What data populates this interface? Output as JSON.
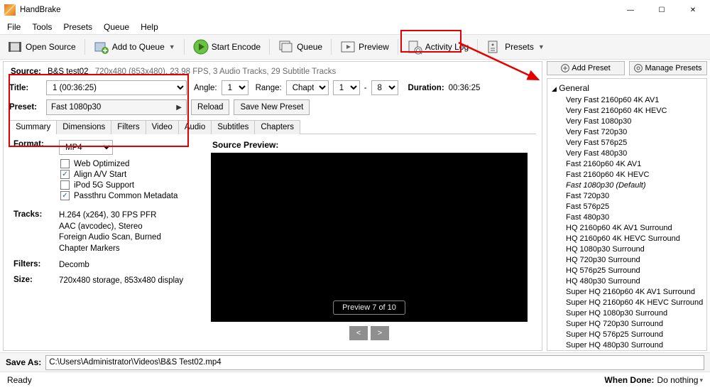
{
  "window": {
    "title": "HandBrake"
  },
  "menu": {
    "file": "File",
    "tools": "Tools",
    "presets": "Presets",
    "queue": "Queue",
    "help": "Help"
  },
  "toolbar": {
    "open_source": "Open Source",
    "add_to_queue": "Add to Queue",
    "start_encode": "Start Encode",
    "queue": "Queue",
    "preview": "Preview",
    "activity_log": "Activity Log",
    "presets": "Presets"
  },
  "source": {
    "label": "Source:",
    "name": "B&S test02",
    "meta": "720x480 (853x480), 23.98 FPS, 3 Audio Tracks, 29 Subtitle Tracks"
  },
  "title": {
    "label": "Title:",
    "value": "1  (00:36:25)",
    "angle_label": "Angle:",
    "angle_value": "1",
    "range_label": "Range:",
    "range_mode": "Chapters",
    "range_from": "1",
    "range_dash": "-",
    "range_to": "8",
    "duration_label": "Duration:",
    "duration_value": "00:36:25"
  },
  "preset": {
    "label": "Preset:",
    "value": "Fast 1080p30",
    "reload": "Reload",
    "save_new": "Save New Preset"
  },
  "tabs": {
    "summary": "Summary",
    "dimensions": "Dimensions",
    "filters": "Filters",
    "video": "Video",
    "audio": "Audio",
    "subtitles": "Subtitles",
    "chapters": "Chapters"
  },
  "format": {
    "label": "Format:",
    "value": "MP4"
  },
  "options": {
    "web_optimized": {
      "label": "Web Optimized",
      "checked": false
    },
    "align_av": {
      "label": "Align A/V Start",
      "checked": true
    },
    "ipod5g": {
      "label": "iPod 5G Support",
      "checked": false
    },
    "passthru_meta": {
      "label": "Passthru Common Metadata",
      "checked": true
    }
  },
  "tracks": {
    "label": "Tracks:",
    "lines": "H.264 (x264), 30 FPS PFR\nAAC (avcodec), Stereo\nForeign Audio Scan, Burned\nChapter Markers"
  },
  "filters": {
    "label": "Filters:",
    "value": "Decomb"
  },
  "size": {
    "label": "Size:",
    "value": "720x480 storage, 853x480 display"
  },
  "source_preview": {
    "label": "Source Preview:",
    "badge": "Preview 7 of 10",
    "prev": "<",
    "next": ">"
  },
  "preset_panel": {
    "add": "Add Preset",
    "manage": "Manage Presets",
    "group": "General",
    "items": [
      "Very Fast 2160p60 4K AV1",
      "Very Fast 2160p60 4K HEVC",
      "Very Fast 1080p30",
      "Very Fast 720p30",
      "Very Fast 576p25",
      "Very Fast 480p30",
      "Fast 2160p60 4K AV1",
      "Fast 2160p60 4K HEVC",
      "Fast 1080p30    (Default)",
      "Fast 720p30",
      "Fast 576p25",
      "Fast 480p30",
      "HQ 2160p60 4K AV1 Surround",
      "HQ 2160p60 4K HEVC Surround",
      "HQ 1080p30 Surround",
      "HQ 720p30 Surround",
      "HQ 576p25 Surround",
      "HQ 480p30 Surround",
      "Super HQ 2160p60 4K AV1 Surround",
      "Super HQ 2160p60 4K HEVC Surround",
      "Super HQ 1080p30 Surround",
      "Super HQ 720p30 Surround",
      "Super HQ 576p25 Surround",
      "Super HQ 480p30 Surround"
    ],
    "default_index": 8
  },
  "save_as": {
    "label": "Save As:",
    "path": "C:\\Users\\Administrator\\Videos\\B&S Test02.mp4"
  },
  "status": {
    "ready": "Ready",
    "when_done_label": "When Done:",
    "when_done_value": "Do nothing"
  }
}
